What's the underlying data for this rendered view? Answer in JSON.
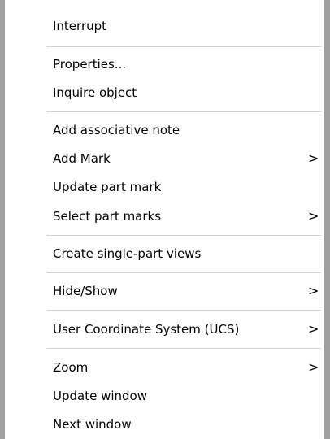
{
  "menu": {
    "items": [
      {
        "label": "Interrupt",
        "arrow": ""
      },
      {
        "label": "Properties...",
        "arrow": ""
      },
      {
        "label": "Inquire object",
        "arrow": ""
      },
      {
        "label": "Add associative note",
        "arrow": ""
      },
      {
        "label": "Add Mark",
        "arrow": ">"
      },
      {
        "label": "Update part mark",
        "arrow": ""
      },
      {
        "label": "Select part marks",
        "arrow": ">"
      },
      {
        "label": "Create single-part views",
        "arrow": ""
      },
      {
        "label": "Hide/Show",
        "arrow": ">"
      },
      {
        "label": "User Coordinate System (UCS)",
        "arrow": ">"
      },
      {
        "label": "Zoom",
        "arrow": ">"
      },
      {
        "label": "Update window",
        "arrow": ""
      },
      {
        "label": "Next window",
        "arrow": ""
      }
    ]
  }
}
